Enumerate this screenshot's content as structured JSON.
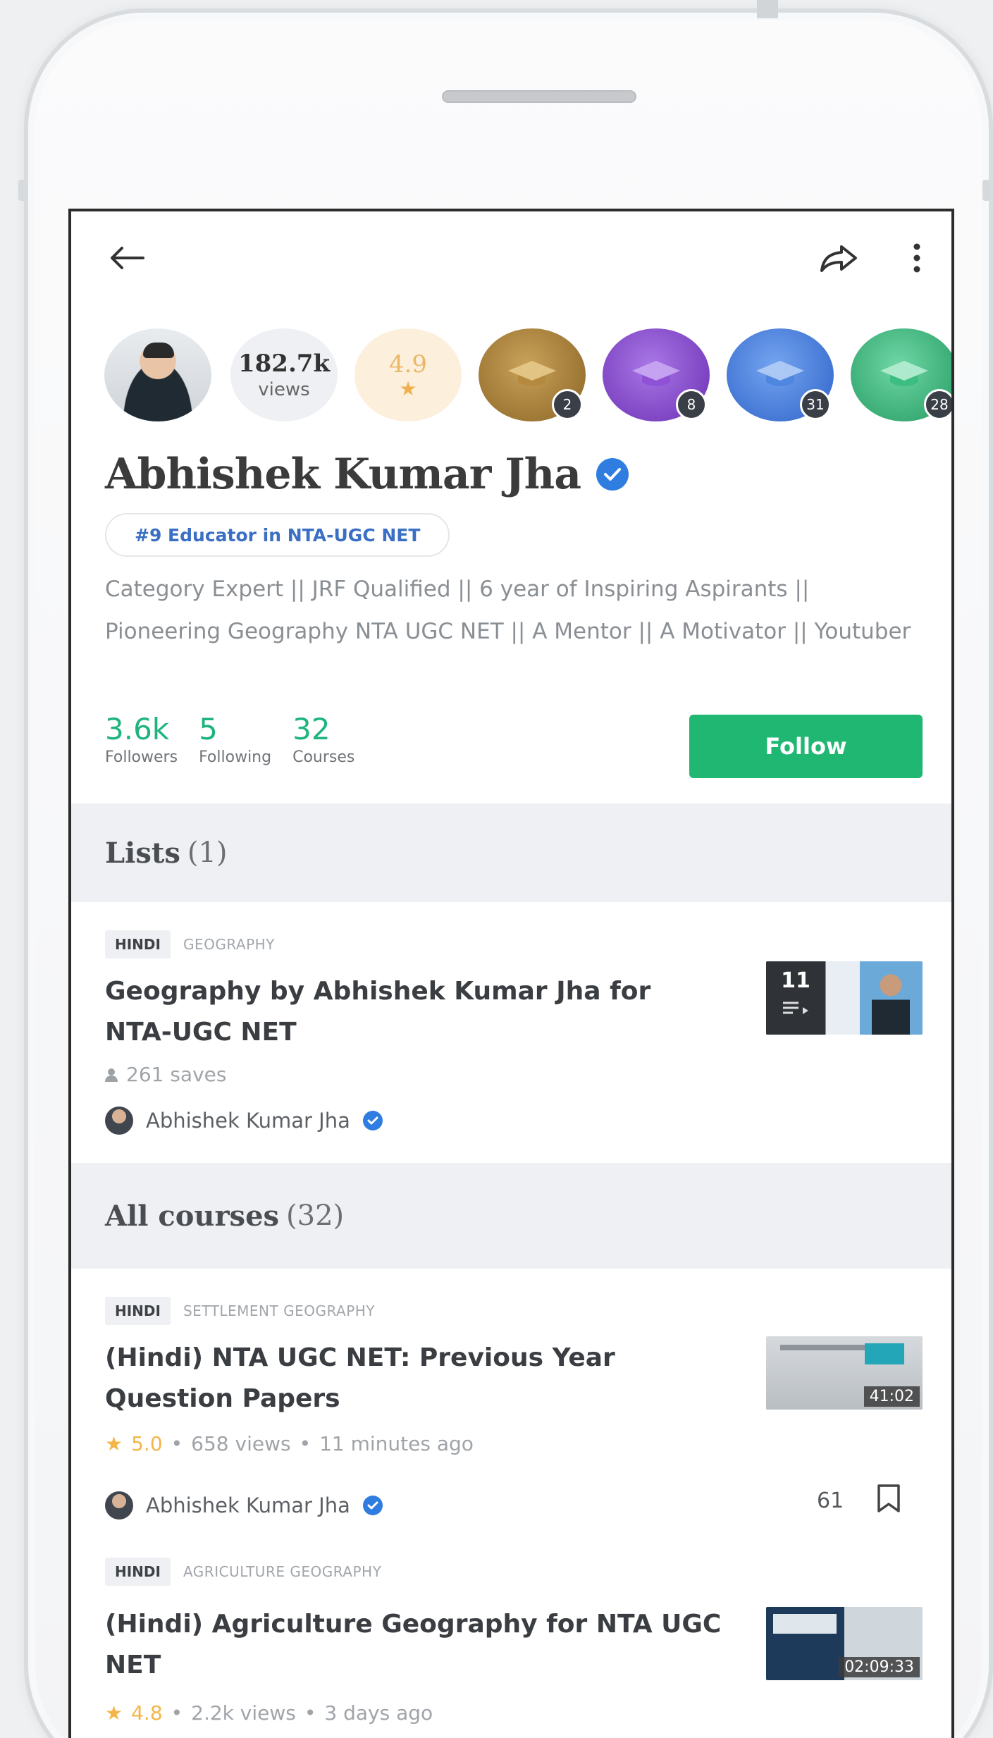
{
  "profile": {
    "views_value": "182.7k",
    "views_label": "views",
    "rating_value": "4.9",
    "rating_star": "★",
    "medals": [
      {
        "count": "2",
        "color": "#9c7a3a"
      },
      {
        "count": "8",
        "color": "#7b3ec1"
      },
      {
        "count": "31",
        "color": "#3f79dc"
      },
      {
        "count": "28",
        "color": "#2fb37b"
      }
    ],
    "name": "Abhishek Kumar Jha",
    "rank": "#9 Educator in NTA-UGC NET",
    "bio": "Category Expert || JRF Qualified || 6 year of Inspiring Aspirants || Pioneering Geography NTA UGC NET || A Mentor || A Motivator || Youtuber",
    "stats": [
      {
        "value": "3.6k",
        "label": "Followers"
      },
      {
        "value": "5",
        "label": "Following"
      },
      {
        "value": "32",
        "label": "Courses"
      }
    ],
    "follow_label": "Follow"
  },
  "lists": {
    "heading": "Lists",
    "count": "(1)",
    "items": [
      {
        "lang": "HINDI",
        "topic": "GEOGRAPHY",
        "title": "Geography by Abhishek Kumar Jha for NTA-UGC NET",
        "saves": "261 saves",
        "author": "Abhishek Kumar Jha",
        "thumb_count": "11"
      }
    ]
  },
  "courses": {
    "heading": "All courses",
    "count": "(32)",
    "items": [
      {
        "lang": "HINDI",
        "topic": "SETTLEMENT GEOGRAPHY",
        "title": "(Hindi) NTA UGC NET: Previous Year Question Papers",
        "rating": "5.0",
        "views": "658 views",
        "age": "11 minutes ago",
        "author": "Abhishek Kumar Jha",
        "duration": "41:02",
        "save_count": "61"
      },
      {
        "lang": "HINDI",
        "topic": "AGRICULTURE GEOGRAPHY",
        "title": "(Hindi) Agriculture Geography for NTA UGC NET",
        "rating": "4.8",
        "views": "2.2k views",
        "age": "3 days ago",
        "duration": "02:09:33"
      }
    ]
  },
  "separator": "•",
  "star": "★",
  "colors": {
    "accent_green": "#1fb772",
    "verified_blue": "#2f7de1",
    "stat_green": "#1fb47d"
  },
  "icons": [
    "back-arrow-icon",
    "share-icon",
    "more-vertical-icon",
    "verified-icon",
    "person-icon",
    "bookmark-icon",
    "star-icon"
  ]
}
